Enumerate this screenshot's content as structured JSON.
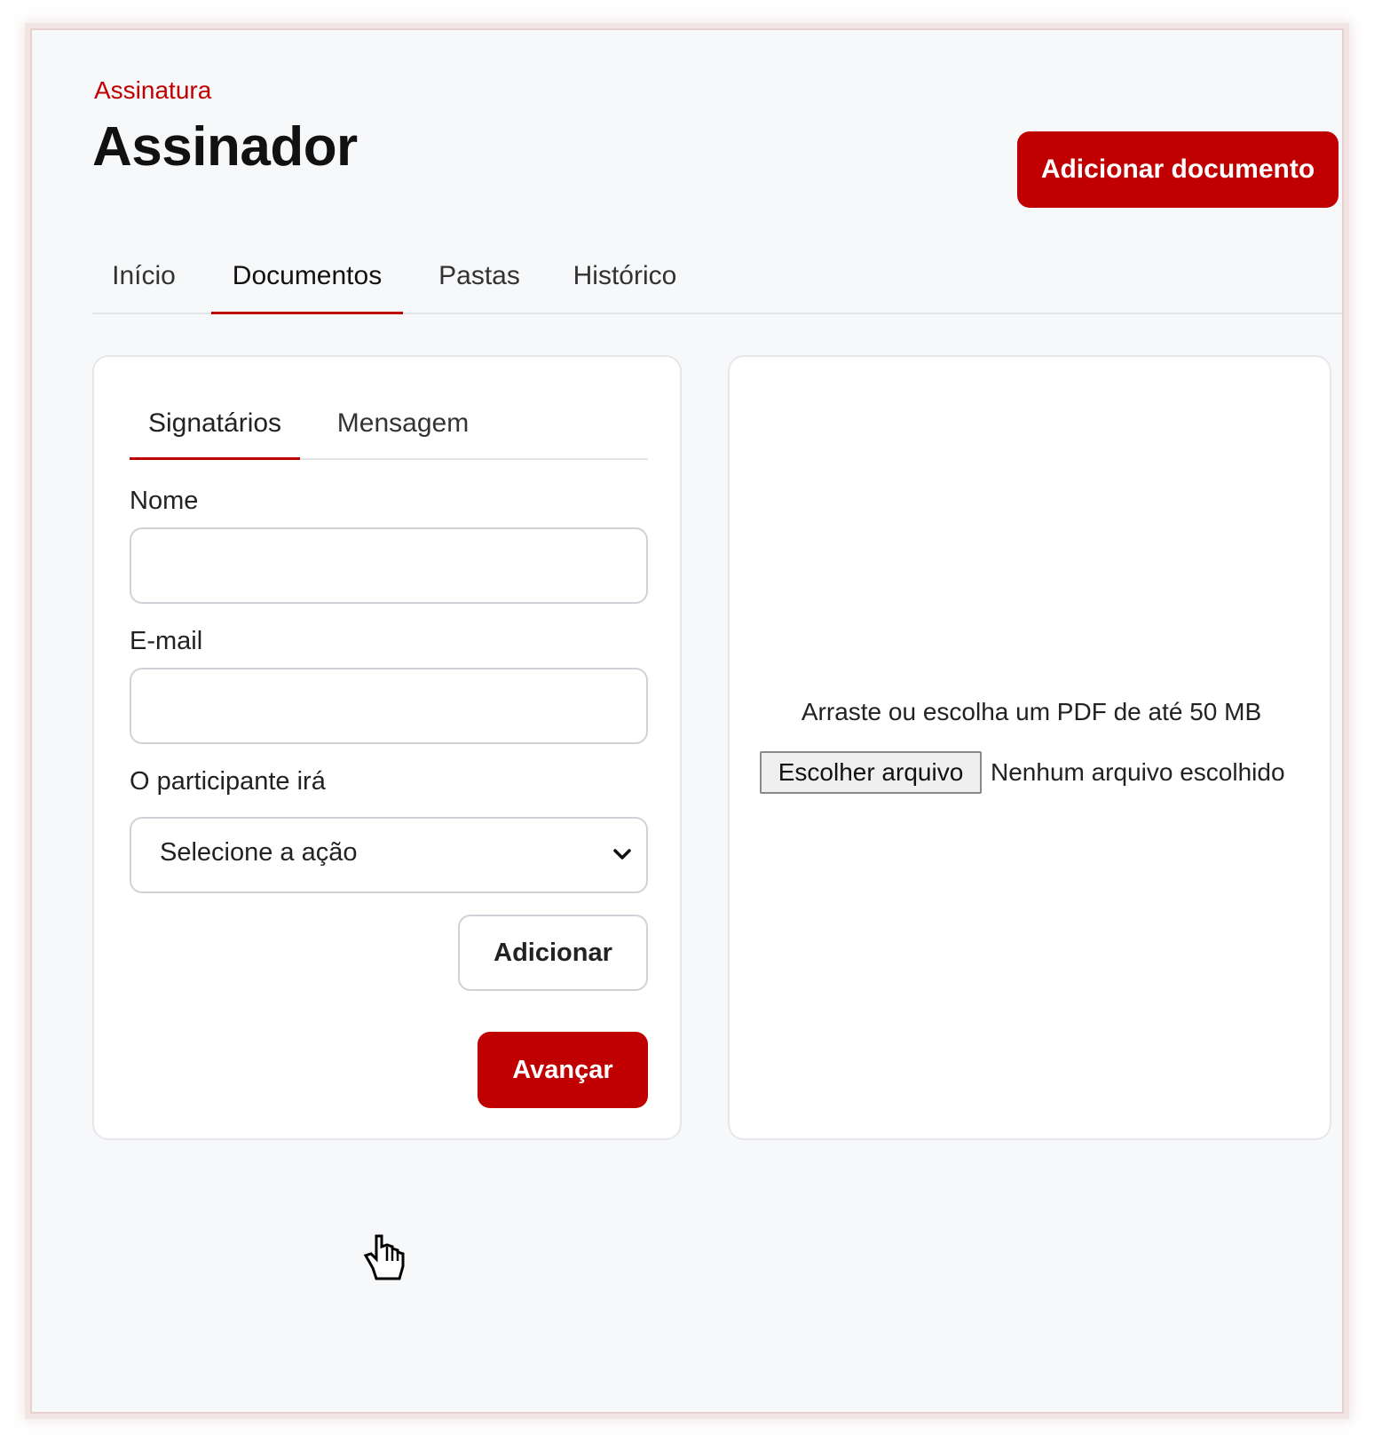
{
  "header": {
    "breadcrumb": "Assinatura",
    "title": "Assinador",
    "add_document_label": "Adicionar documento"
  },
  "top_tabs": [
    {
      "label": "Início",
      "active": false
    },
    {
      "label": "Documentos",
      "active": true
    },
    {
      "label": "Pastas",
      "active": false
    },
    {
      "label": "Histórico",
      "active": false
    }
  ],
  "form": {
    "tabs": [
      {
        "label": "Signatários",
        "active": true
      },
      {
        "label": "Mensagem",
        "active": false
      }
    ],
    "name_label": "Nome",
    "name_value": "",
    "email_label": "E-mail",
    "email_value": "",
    "action_label": "O participante irá",
    "action_selected": "Selecione a ação",
    "add_label": "Adicionar",
    "next_label": "Avançar"
  },
  "upload": {
    "hint": "Arraste ou escolha um PDF de até 50 MB",
    "choose_file_label": "Escolher arquivo",
    "no_file_text": "Nenhum arquivo escolhido"
  },
  "colors": {
    "accent": "#c00000",
    "background": "#f7f8fa",
    "card": "#ffffff",
    "border": "#cfd2d7"
  }
}
